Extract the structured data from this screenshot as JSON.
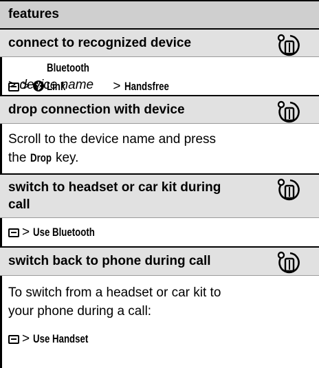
{
  "header": {
    "title": "features"
  },
  "sections": [
    {
      "title": "connect to recognized device",
      "line1": {
        "gt1": ">",
        "item1": "Bluetooth Link",
        "gt2": ">",
        "item2": "Handsfree"
      },
      "line2": {
        "gt": ">",
        "item": "device name"
      }
    },
    {
      "title": "drop connection with device",
      "line1": "Scroll to the device name and press",
      "line2": {
        "pre": "the",
        "key": "Drop",
        "post": "key."
      }
    },
    {
      "title_line1": "switch to headset or car kit during",
      "title_line2": "call",
      "line1": {
        "gt": ">",
        "item": "Use Bluetooth"
      }
    },
    {
      "title": "switch back to phone during call",
      "line1": "To switch from a headset or car kit to",
      "line2": "your phone during a call:",
      "line3": {
        "gt": ">",
        "item": "Use Handset"
      }
    }
  ],
  "icons": {
    "feature_icon": "network-phone-icon",
    "menu_key": "menu-key-icon",
    "bluetooth": "bluetooth-icon"
  }
}
